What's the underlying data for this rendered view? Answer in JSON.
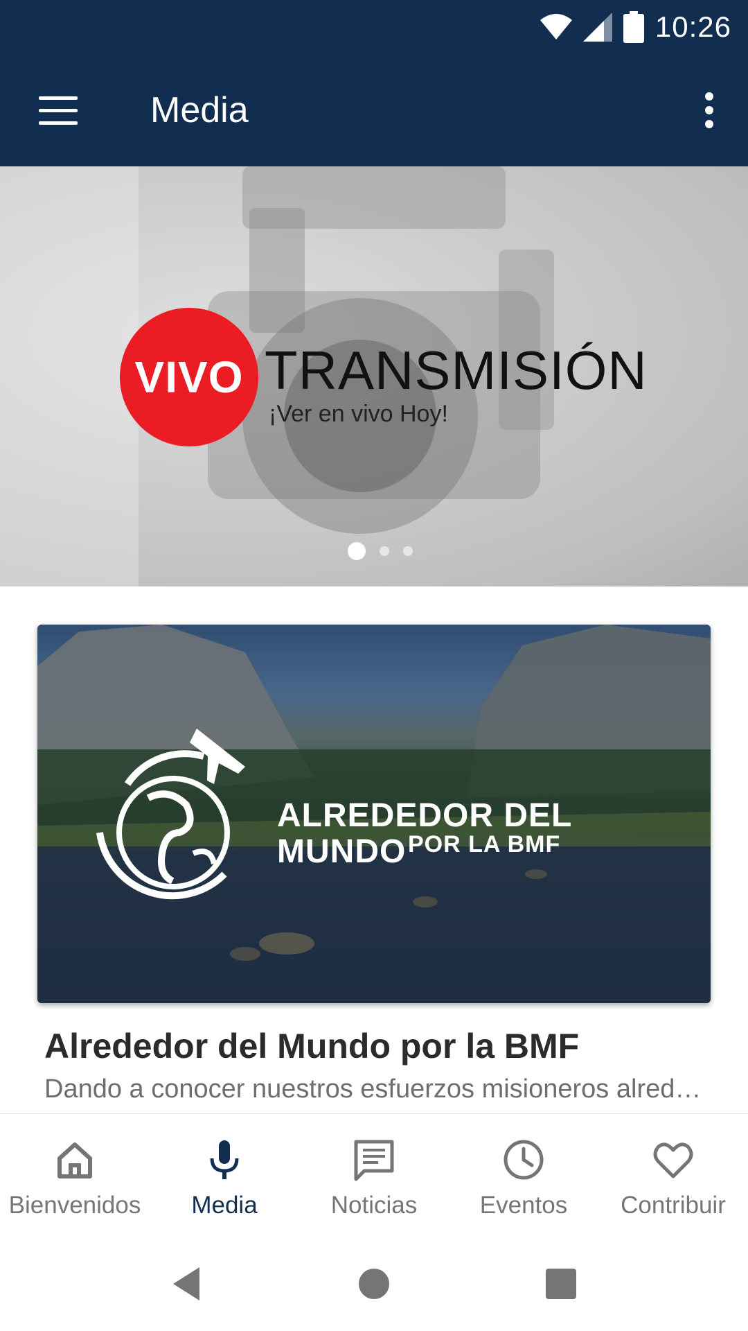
{
  "status_bar": {
    "time": "10:26",
    "icons": [
      "wifi-icon",
      "signal-icon",
      "battery-icon"
    ]
  },
  "app_bar": {
    "title": "Media",
    "menu_icon": "hamburger-menu-icon",
    "more_icon": "more-vert-icon"
  },
  "hero": {
    "badge_text": "VIVO",
    "headline": "TRANSMISIÓN",
    "subline": "¡Ver en vivo Hoy!",
    "slides_total": 3,
    "active_slide": 1
  },
  "card": {
    "image_headline": "ALREDEDOR DEL MUNDO",
    "image_subline": "POR LA BMF",
    "title": "Alrededor del Mundo por la BMF",
    "description": "Dando a conocer nuestros esfuerzos misioneros alrededor del mundo"
  },
  "bottom_nav": {
    "items": [
      {
        "label": "Bienvenidos",
        "icon": "home-icon",
        "active": false
      },
      {
        "label": "Media",
        "icon": "microphone-icon",
        "active": true
      },
      {
        "label": "Noticias",
        "icon": "news-icon",
        "active": false
      },
      {
        "label": "Eventos",
        "icon": "clock-icon",
        "active": false
      },
      {
        "label": "Contribuir",
        "icon": "heart-icon",
        "active": false
      }
    ]
  },
  "colors": {
    "primary": "#112d50",
    "accent_red": "#ec1c24",
    "inactive": "#757575"
  }
}
